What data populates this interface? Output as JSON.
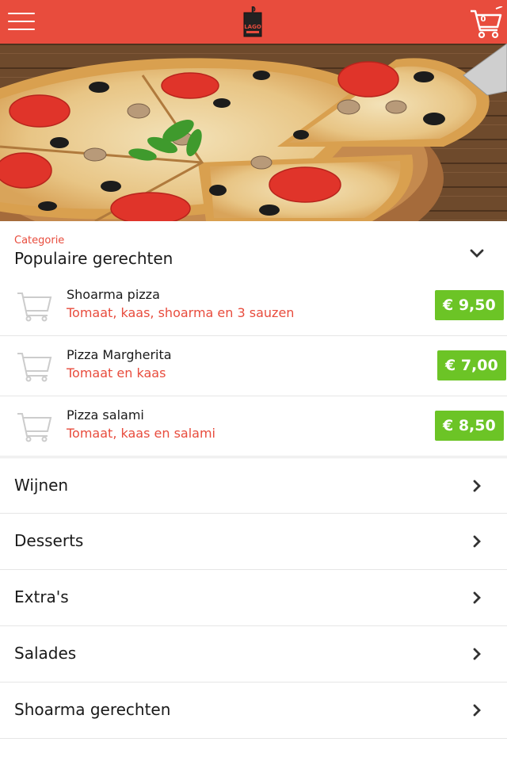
{
  "header": {
    "menu_icon": "hamburger-menu-icon",
    "logo_text": "LAGO",
    "cart_icon": "shopping-cart-icon",
    "cart_count": "0",
    "brand_color": "#e84c3d"
  },
  "hero": {
    "image": "pizza-slices-on-wooden-board"
  },
  "category": {
    "label": "Categorie",
    "selected": "Populaire gerechten",
    "chevron_icon": "chevron-down-icon"
  },
  "products": [
    {
      "name": "Shoarma pizza",
      "description": "Tomaat, kaas, shoarma en 3 sauzen",
      "price": "€ 9,50"
    },
    {
      "name": "Pizza Margherita",
      "description": "Tomaat en kaas",
      "price": "€ 7,00"
    },
    {
      "name": "Pizza salami",
      "description": "Tomaat, kaas en salami",
      "price": "€ 8,50"
    }
  ],
  "categories": [
    {
      "label": "Wijnen"
    },
    {
      "label": "Desserts"
    },
    {
      "label": "Extra's"
    },
    {
      "label": "Salades"
    },
    {
      "label": "Shoarma gerechten"
    }
  ],
  "colors": {
    "accent": "#e84c3d",
    "price_badge": "#6cc426"
  }
}
